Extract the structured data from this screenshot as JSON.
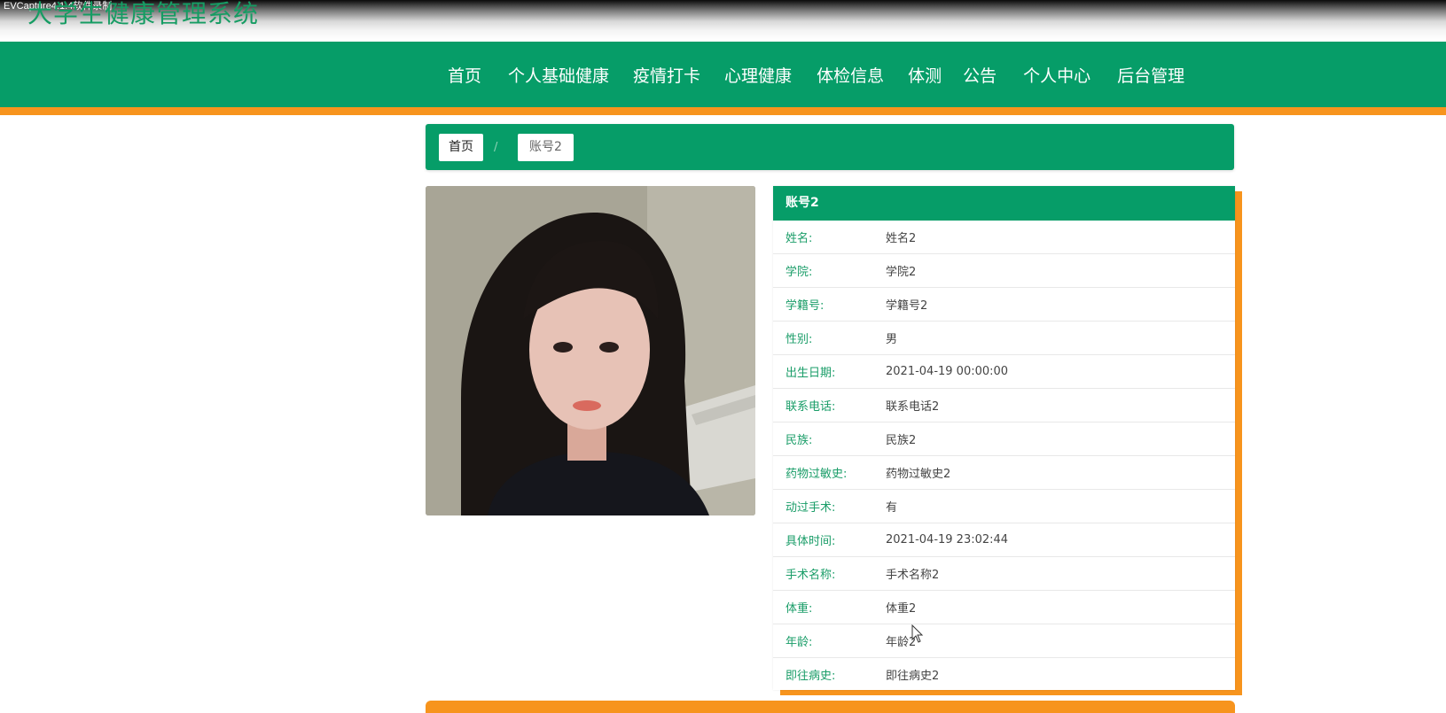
{
  "recorder_label": "EVCapture4.1.4软件录制",
  "site_title": "大学生健康管理系统",
  "nav": [
    {
      "label": "首页",
      "name": "home",
      "x": 0
    },
    {
      "label": "个人基础健康",
      "name": "basic-health",
      "x": 0
    },
    {
      "label": "疫情打卡",
      "name": "epidemic-checkin",
      "x": 0
    },
    {
      "label": "心理健康",
      "name": "mental-health",
      "x": 0
    },
    {
      "label": "体检信息",
      "name": "physical-exam",
      "x": 0
    },
    {
      "label": "体测",
      "name": "fitness-test",
      "x": 0
    },
    {
      "label": "公告",
      "name": "announcement",
      "x": 0
    },
    {
      "label": "个人中心",
      "name": "personal-center",
      "x": 0
    },
    {
      "label": "后台管理",
      "name": "admin",
      "x": 0
    }
  ],
  "breadcrumb": {
    "home": "首页",
    "separator": "/",
    "current": "账号2"
  },
  "profile": {
    "title": "账号2",
    "fields": [
      {
        "label": "姓名:",
        "value": "姓名2"
      },
      {
        "label": "学院:",
        "value": "学院2"
      },
      {
        "label": "学籍号:",
        "value": "学籍号2"
      },
      {
        "label": "性别:",
        "value": "男"
      },
      {
        "label": "出生日期:",
        "value": "2021-04-19 00:00:00"
      },
      {
        "label": "联系电话:",
        "value": "联系电话2"
      },
      {
        "label": "民族:",
        "value": "民族2"
      },
      {
        "label": "药物过敏史:",
        "value": "药物过敏史2"
      },
      {
        "label": "动过手术:",
        "value": "有"
      },
      {
        "label": "具体时间:",
        "value": "2021-04-19 23:02:44"
      },
      {
        "label": "手术名称:",
        "value": "手术名称2"
      },
      {
        "label": "体重:",
        "value": "体重2"
      },
      {
        "label": "年龄:",
        "value": "年龄2"
      },
      {
        "label": "即往病史:",
        "value": "即往病史2"
      }
    ]
  },
  "colors": {
    "primary": "#069d68",
    "accent": "#f7941d",
    "label": "#1a9d68"
  }
}
